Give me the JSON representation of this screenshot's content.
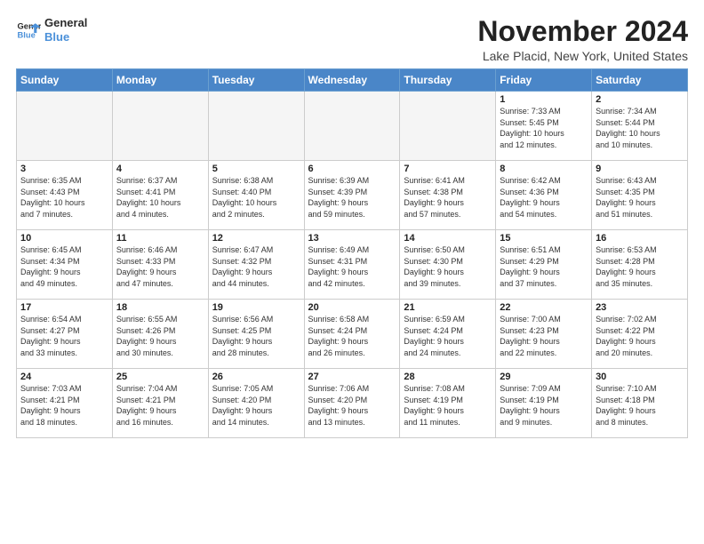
{
  "logo": {
    "line1": "General",
    "line2": "Blue"
  },
  "title": "November 2024",
  "location": "Lake Placid, New York, United States",
  "weekdays": [
    "Sunday",
    "Monday",
    "Tuesday",
    "Wednesday",
    "Thursday",
    "Friday",
    "Saturday"
  ],
  "weeks": [
    [
      {
        "day": "",
        "info": ""
      },
      {
        "day": "",
        "info": ""
      },
      {
        "day": "",
        "info": ""
      },
      {
        "day": "",
        "info": ""
      },
      {
        "day": "",
        "info": ""
      },
      {
        "day": "1",
        "info": "Sunrise: 7:33 AM\nSunset: 5:45 PM\nDaylight: 10 hours\nand 12 minutes."
      },
      {
        "day": "2",
        "info": "Sunrise: 7:34 AM\nSunset: 5:44 PM\nDaylight: 10 hours\nand 10 minutes."
      }
    ],
    [
      {
        "day": "3",
        "info": "Sunrise: 6:35 AM\nSunset: 4:43 PM\nDaylight: 10 hours\nand 7 minutes."
      },
      {
        "day": "4",
        "info": "Sunrise: 6:37 AM\nSunset: 4:41 PM\nDaylight: 10 hours\nand 4 minutes."
      },
      {
        "day": "5",
        "info": "Sunrise: 6:38 AM\nSunset: 4:40 PM\nDaylight: 10 hours\nand 2 minutes."
      },
      {
        "day": "6",
        "info": "Sunrise: 6:39 AM\nSunset: 4:39 PM\nDaylight: 9 hours\nand 59 minutes."
      },
      {
        "day": "7",
        "info": "Sunrise: 6:41 AM\nSunset: 4:38 PM\nDaylight: 9 hours\nand 57 minutes."
      },
      {
        "day": "8",
        "info": "Sunrise: 6:42 AM\nSunset: 4:36 PM\nDaylight: 9 hours\nand 54 minutes."
      },
      {
        "day": "9",
        "info": "Sunrise: 6:43 AM\nSunset: 4:35 PM\nDaylight: 9 hours\nand 51 minutes."
      }
    ],
    [
      {
        "day": "10",
        "info": "Sunrise: 6:45 AM\nSunset: 4:34 PM\nDaylight: 9 hours\nand 49 minutes."
      },
      {
        "day": "11",
        "info": "Sunrise: 6:46 AM\nSunset: 4:33 PM\nDaylight: 9 hours\nand 47 minutes."
      },
      {
        "day": "12",
        "info": "Sunrise: 6:47 AM\nSunset: 4:32 PM\nDaylight: 9 hours\nand 44 minutes."
      },
      {
        "day": "13",
        "info": "Sunrise: 6:49 AM\nSunset: 4:31 PM\nDaylight: 9 hours\nand 42 minutes."
      },
      {
        "day": "14",
        "info": "Sunrise: 6:50 AM\nSunset: 4:30 PM\nDaylight: 9 hours\nand 39 minutes."
      },
      {
        "day": "15",
        "info": "Sunrise: 6:51 AM\nSunset: 4:29 PM\nDaylight: 9 hours\nand 37 minutes."
      },
      {
        "day": "16",
        "info": "Sunrise: 6:53 AM\nSunset: 4:28 PM\nDaylight: 9 hours\nand 35 minutes."
      }
    ],
    [
      {
        "day": "17",
        "info": "Sunrise: 6:54 AM\nSunset: 4:27 PM\nDaylight: 9 hours\nand 33 minutes."
      },
      {
        "day": "18",
        "info": "Sunrise: 6:55 AM\nSunset: 4:26 PM\nDaylight: 9 hours\nand 30 minutes."
      },
      {
        "day": "19",
        "info": "Sunrise: 6:56 AM\nSunset: 4:25 PM\nDaylight: 9 hours\nand 28 minutes."
      },
      {
        "day": "20",
        "info": "Sunrise: 6:58 AM\nSunset: 4:24 PM\nDaylight: 9 hours\nand 26 minutes."
      },
      {
        "day": "21",
        "info": "Sunrise: 6:59 AM\nSunset: 4:24 PM\nDaylight: 9 hours\nand 24 minutes."
      },
      {
        "day": "22",
        "info": "Sunrise: 7:00 AM\nSunset: 4:23 PM\nDaylight: 9 hours\nand 22 minutes."
      },
      {
        "day": "23",
        "info": "Sunrise: 7:02 AM\nSunset: 4:22 PM\nDaylight: 9 hours\nand 20 minutes."
      }
    ],
    [
      {
        "day": "24",
        "info": "Sunrise: 7:03 AM\nSunset: 4:21 PM\nDaylight: 9 hours\nand 18 minutes."
      },
      {
        "day": "25",
        "info": "Sunrise: 7:04 AM\nSunset: 4:21 PM\nDaylight: 9 hours\nand 16 minutes."
      },
      {
        "day": "26",
        "info": "Sunrise: 7:05 AM\nSunset: 4:20 PM\nDaylight: 9 hours\nand 14 minutes."
      },
      {
        "day": "27",
        "info": "Sunrise: 7:06 AM\nSunset: 4:20 PM\nDaylight: 9 hours\nand 13 minutes."
      },
      {
        "day": "28",
        "info": "Sunrise: 7:08 AM\nSunset: 4:19 PM\nDaylight: 9 hours\nand 11 minutes."
      },
      {
        "day": "29",
        "info": "Sunrise: 7:09 AM\nSunset: 4:19 PM\nDaylight: 9 hours\nand 9 minutes."
      },
      {
        "day": "30",
        "info": "Sunrise: 7:10 AM\nSunset: 4:18 PM\nDaylight: 9 hours\nand 8 minutes."
      }
    ]
  ]
}
